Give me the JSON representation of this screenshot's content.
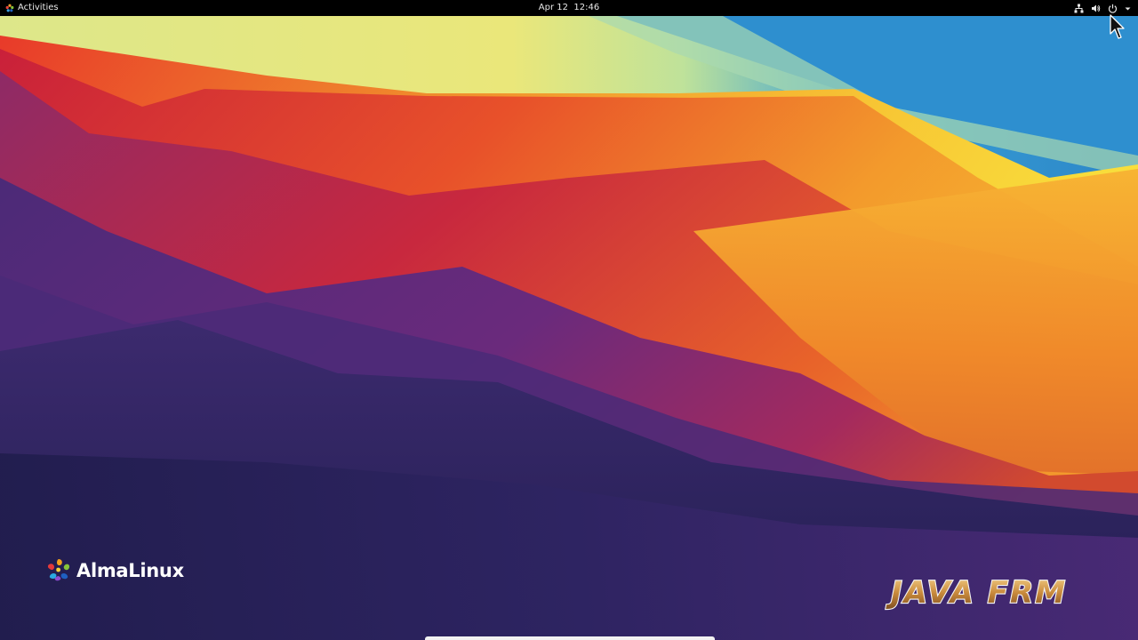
{
  "topbar": {
    "activities_label": "Activities",
    "activities_icon": "almalinux-icon",
    "clock": "Apr 12  12:46",
    "tray_icons": [
      "network-wired-icon",
      "volume-icon",
      "power-icon",
      "chevron-down-icon"
    ]
  },
  "desktop": {
    "logo_text": "AlmaLinux",
    "logo_icon": "almalinux-icon",
    "watermark_text": "JAVA FRM",
    "colors": {
      "topbar": "#000000",
      "wallpaper_yellow": "#f6e03a",
      "wallpaper_orange": "#ee8a2a",
      "wallpaper_red": "#d8262e",
      "wallpaper_purple": "#5a2a7c",
      "wallpaper_navy": "#231f52",
      "wallpaper_blue": "#2d8fd0"
    }
  }
}
